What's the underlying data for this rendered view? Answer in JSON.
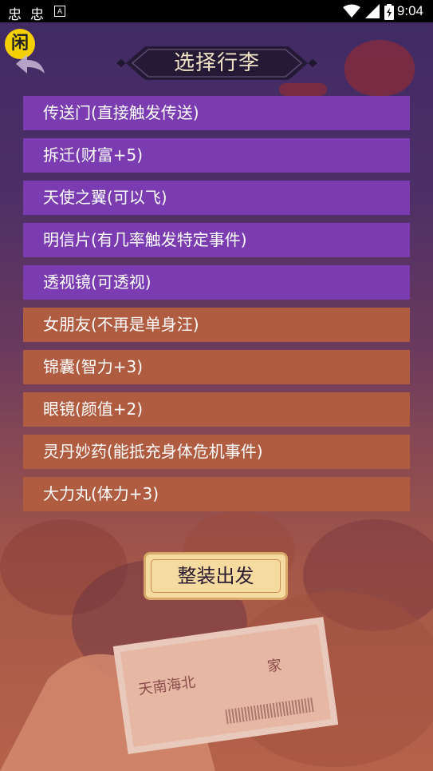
{
  "status_bar": {
    "left_icons": [
      "忠",
      "忠"
    ],
    "a_icon": "A",
    "time": "9:04"
  },
  "header": {
    "badge_text": "闲",
    "title": "选择行李"
  },
  "luggage_items": [
    {
      "label": "传送门(直接触发传送)",
      "color": "purple"
    },
    {
      "label": "拆迁(财富+5)",
      "color": "purple"
    },
    {
      "label": "天使之翼(可以飞)",
      "color": "purple"
    },
    {
      "label": "明信片(有几率触发特定事件)",
      "color": "purple"
    },
    {
      "label": "透视镜(可透视)",
      "color": "purple"
    },
    {
      "label": "女朋友(不再是单身汪)",
      "color": "orange"
    },
    {
      "label": "锦囊(智力+3)",
      "color": "orange"
    },
    {
      "label": "眼镜(颜值+2)",
      "color": "orange"
    },
    {
      "label": "灵丹妙药(能抵充身体危机事件)",
      "color": "orange"
    },
    {
      "label": "大力丸(体力+3)",
      "color": "orange"
    }
  ],
  "depart_button": {
    "label": "整装出发"
  },
  "ticket": {
    "from": "天南海北",
    "to": "家"
  },
  "colors": {
    "purple_item": "#7a3cb0",
    "orange_item": "#b05c40",
    "button_fill": "#f5dba0",
    "title_text": "#f1e2c6"
  }
}
